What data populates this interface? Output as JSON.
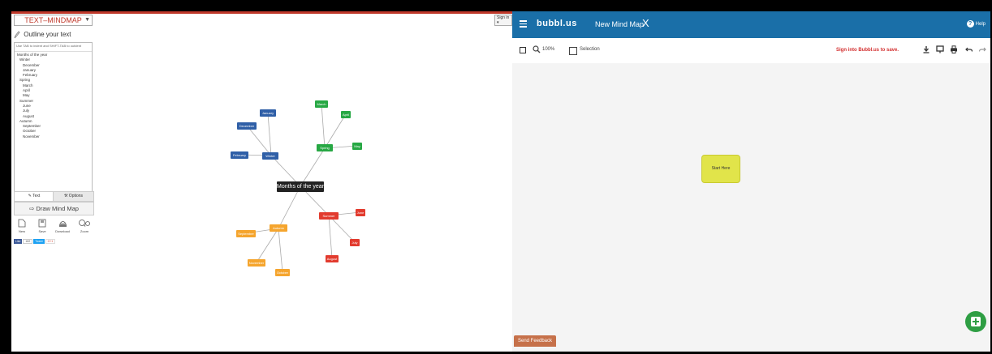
{
  "left_app": {
    "selector_label": "TEXT–MINDMAP",
    "sign_in": "Sign in ▾",
    "outline_title": "Outline your text",
    "outline_hint": "Use TAB to indent and SHIFT-TAB to outdent",
    "outline_lines": [
      {
        "text": "Months of the year",
        "level": 0
      },
      {
        "text": "Winter",
        "level": 1
      },
      {
        "text": "December",
        "level": 2
      },
      {
        "text": "January",
        "level": 2
      },
      {
        "text": "February",
        "level": 2
      },
      {
        "text": "Spring",
        "level": 1
      },
      {
        "text": "March",
        "level": 2
      },
      {
        "text": "April",
        "level": 2
      },
      {
        "text": "May",
        "level": 2
      },
      {
        "text": "Summer",
        "level": 1
      },
      {
        "text": "June",
        "level": 2
      },
      {
        "text": "July",
        "level": 2
      },
      {
        "text": "August",
        "level": 2
      },
      {
        "text": "Autumn",
        "level": 1
      },
      {
        "text": "September",
        "level": 2
      },
      {
        "text": "October",
        "level": 2
      },
      {
        "text": "November",
        "level": 2
      }
    ],
    "tab_text": "✎ Text",
    "tab_options": "⚒ Options",
    "draw_button": "⇨ Draw Mind Map",
    "tools": {
      "new": "New",
      "save": "Save",
      "download": "Download",
      "zoom": "Zoom"
    },
    "share": {
      "facebook": "Like",
      "count": "182",
      "twitter": "Tweet",
      "gplus": "G+1"
    },
    "mindmap": {
      "root": "Months of the year",
      "winter": "Winter",
      "december": "December",
      "january": "January",
      "february": "February",
      "spring": "Spring",
      "march": "March",
      "april": "April",
      "may": "May",
      "summer": "Summer",
      "june": "June",
      "july": "July",
      "august": "August",
      "autumn": "Autumn",
      "september": "September",
      "october": "October",
      "november": "November"
    }
  },
  "right_app": {
    "brand": "bubbl.us",
    "doc_title": "New Mind Map",
    "close_glyph": "X",
    "help": "Help",
    "zoom": "100%",
    "selection": "Selection",
    "sign_in_save": "Sign into Bubbl.us to save.",
    "start_node": "Start Here",
    "feedback": "Send Feedback"
  },
  "colors": {
    "winter": "#2f5fa7",
    "spring": "#27a844",
    "summer": "#e23b2e",
    "autumn": "#f5a52e",
    "bubbl_bar": "#1a6fa8",
    "start_node": "#e1e44a",
    "fab": "#2e9e43"
  },
  "icons": [
    "pencil-icon",
    "file-icon",
    "save-icon",
    "download-icon",
    "zoom-icon",
    "menu-icon",
    "help-icon",
    "fit-icon",
    "magnify-icon",
    "selection-checkbox",
    "download-arrow-icon",
    "tablet-icon",
    "print-icon",
    "undo-icon",
    "redo-icon",
    "add-icon"
  ]
}
